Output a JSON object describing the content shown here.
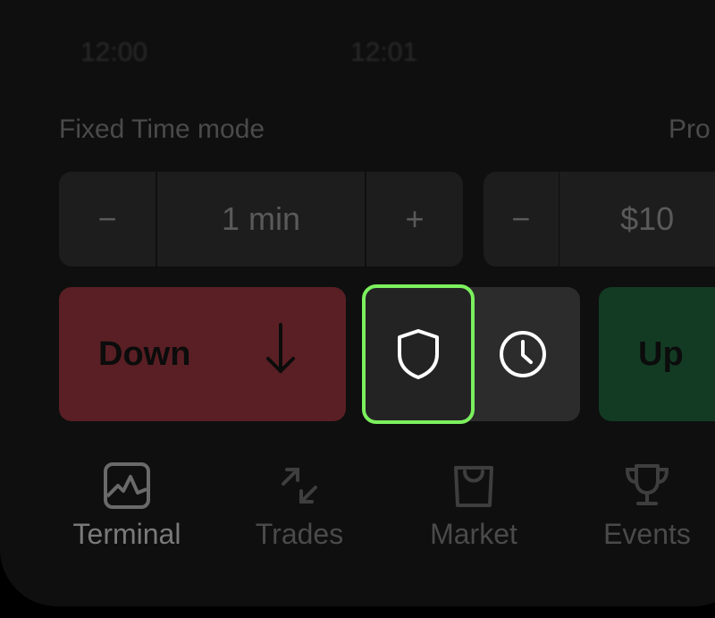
{
  "chart": {
    "time_labels": [
      "12:00",
      "12:01"
    ]
  },
  "trade_panel": {
    "mode_label": "Fixed Time mode",
    "profit_label": "Pro",
    "duration": {
      "decrement": "−",
      "value": "1 min",
      "increment": "+"
    },
    "amount": {
      "decrement": "−",
      "value": "$10"
    }
  },
  "actions": {
    "down_label": "Down",
    "up_label": "Up",
    "shield_icon": "shield-icon",
    "clock_icon": "clock-icon"
  },
  "colors": {
    "down": "#5a1f24",
    "up": "#133b24",
    "highlight": "#7cf05e"
  },
  "tabs": [
    {
      "label": "Terminal",
      "icon": "chart-icon",
      "active": true
    },
    {
      "label": "Trades",
      "icon": "arrows-icon",
      "active": false
    },
    {
      "label": "Market",
      "icon": "bag-icon",
      "active": false
    },
    {
      "label": "Events",
      "icon": "trophy-icon",
      "active": false
    }
  ]
}
